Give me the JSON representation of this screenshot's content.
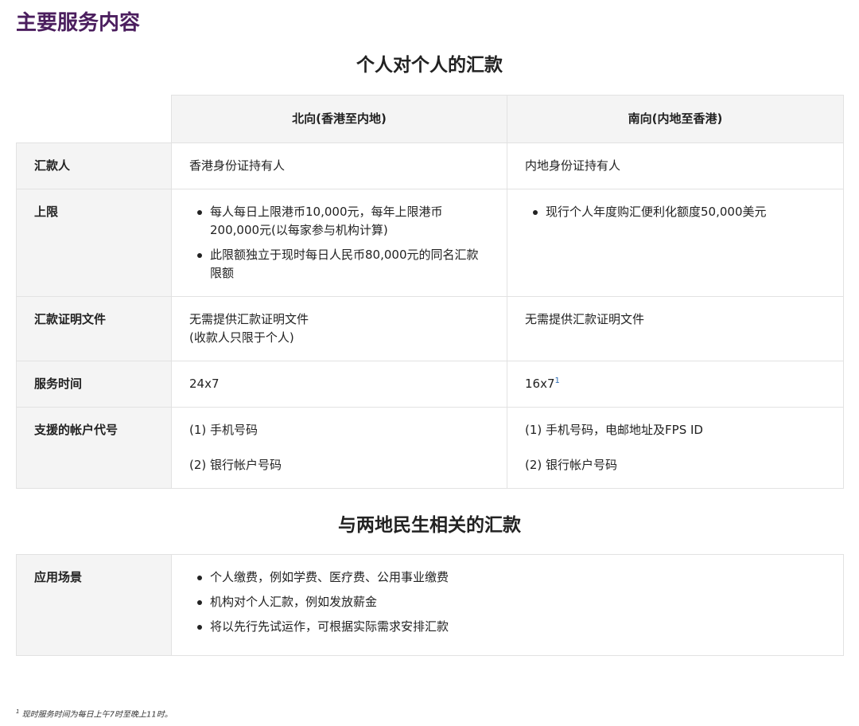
{
  "main_heading": "主要服务内容",
  "section1": {
    "title": "个人对个人的汇款",
    "columns": [
      "北向(香港至内地)",
      "南向(内地至香港)"
    ],
    "rows": {
      "remitter": {
        "label": "汇款人",
        "north": "香港身份证持有人",
        "south": "内地身份证持有人"
      },
      "limit": {
        "label": "上限",
        "north": [
          "每人每日上限港币10,000元，每年上限港币200,000元(以每家参与机构计算)",
          "此限额独立于现时每日人民币80,000元的同名汇款限额"
        ],
        "south": [
          "现行个人年度购汇便利化额度50,000美元"
        ]
      },
      "docs": {
        "label": "汇款证明文件",
        "north_line1": "无需提供汇款证明文件",
        "north_line2": "(收款人只限于个人)",
        "south": "无需提供汇款证明文件"
      },
      "hours": {
        "label": "服务时间",
        "north": "24x7",
        "south": "16x7",
        "south_ref": "1"
      },
      "accounts": {
        "label": "支援的帐户代号",
        "north": [
          "(1) 手机号码",
          "(2) 银行帐户号码"
        ],
        "south": [
          "(1) 手机号码，电邮地址及FPS ID",
          "(2) 银行帐户号码"
        ]
      }
    }
  },
  "section2": {
    "title": "与两地民生相关的汇款",
    "label": "应用场景",
    "items": [
      "个人缴费，例如学费、医疗费、公用事业缴费",
      "机构对个人汇款，例如发放薪金",
      "将以先行先试运作，可根据实际需求安排汇款"
    ]
  },
  "footnote": {
    "ref": "1",
    "text": "现时服务时间为每日上午7时至晚上11时。"
  },
  "colors": {
    "heading": "#4b1e5e",
    "header_bg": "#f4f4f4",
    "border": "#e2e2e2",
    "link": "#2a6ab2"
  }
}
